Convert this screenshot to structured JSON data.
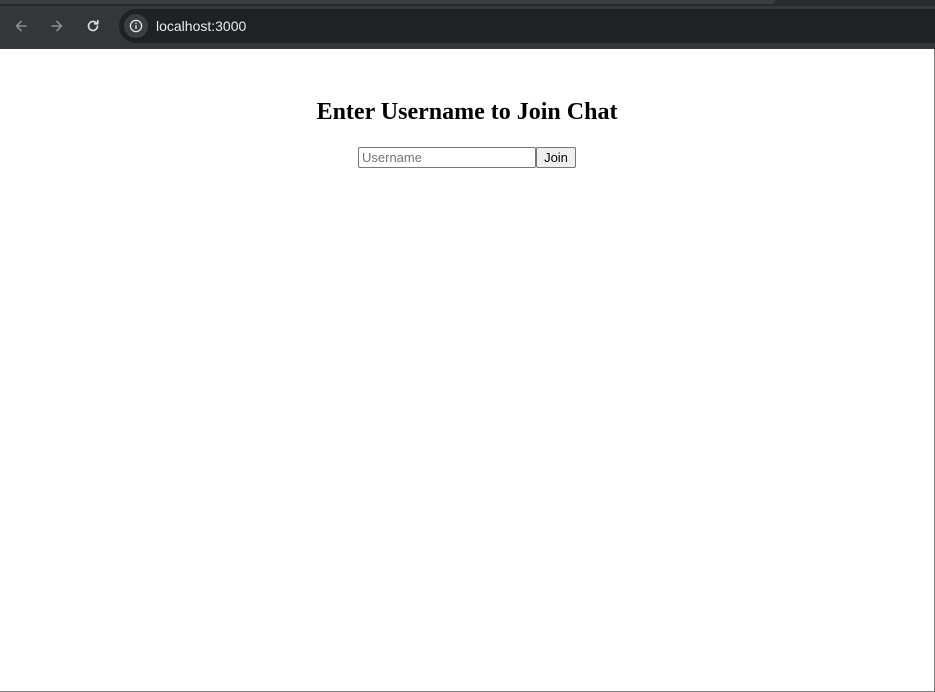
{
  "browser": {
    "url": "localhost:3000",
    "icons": {
      "back": "arrow-left-icon",
      "forward": "arrow-right-icon",
      "reload": "reload-icon",
      "site_info": "info-icon"
    }
  },
  "page": {
    "title": "Enter Username to Join Chat",
    "form": {
      "username_placeholder": "Username",
      "username_value": "",
      "join_label": "Join"
    }
  },
  "colors": {
    "chrome_bg": "#35363a",
    "omnibox_bg": "#202124",
    "url_text": "#e8eaed",
    "page_bg": "#ffffff"
  }
}
